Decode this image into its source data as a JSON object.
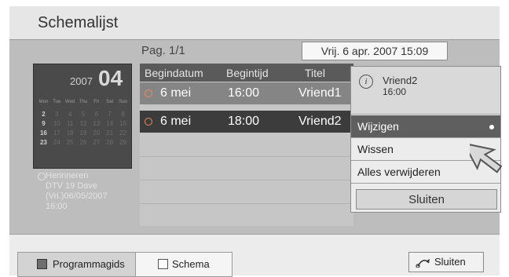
{
  "title": "Schemalijst",
  "page_indicator": "Pag. 1/1",
  "datetime": "Vrij. 6 apr. 2007 15:09",
  "calendar": {
    "year": "2007",
    "month": "04",
    "weekdays": [
      "Mon",
      "Tue",
      "Wed",
      "Thu",
      "Fri",
      "Sat",
      "Sun"
    ],
    "weeks": [
      [
        "2",
        "3",
        "4",
        "5",
        "6",
        "7",
        "8"
      ],
      [
        "9",
        "10",
        "11",
        "12",
        "13",
        "14",
        "15"
      ],
      [
        "16",
        "17",
        "18",
        "19",
        "20",
        "21",
        "22"
      ],
      [
        "23",
        "24",
        "25",
        "26",
        "27",
        "28",
        "29"
      ]
    ]
  },
  "reminder": {
    "line1": "Herinneren",
    "line2": "DTV 19 Dave",
    "line3": "(Vri.)06/05/2007",
    "line4": "16:00"
  },
  "table": {
    "headers": [
      "Begindatum",
      "Begintijd",
      "Titel"
    ],
    "rows": [
      {
        "date": "6 mei",
        "time": "16:00",
        "title": "Vriend1"
      },
      {
        "date": "6 mei",
        "time": "18:00",
        "title": "Vriend2"
      }
    ]
  },
  "popup": {
    "info_icon": "i",
    "info_name": "Vriend2",
    "info_time": "16:00",
    "options": [
      "Wijzigen",
      "Wissen",
      "Alles verwijderen"
    ],
    "close": "Sluiten"
  },
  "bottom": {
    "tab1": "Programmagids",
    "tab2": "Schema",
    "exit": "Sluiten"
  },
  "colors": {
    "accent_clock": "#f08a5a",
    "selected_row": "#3c3c3c",
    "selected_option": "#5f5f5f"
  }
}
